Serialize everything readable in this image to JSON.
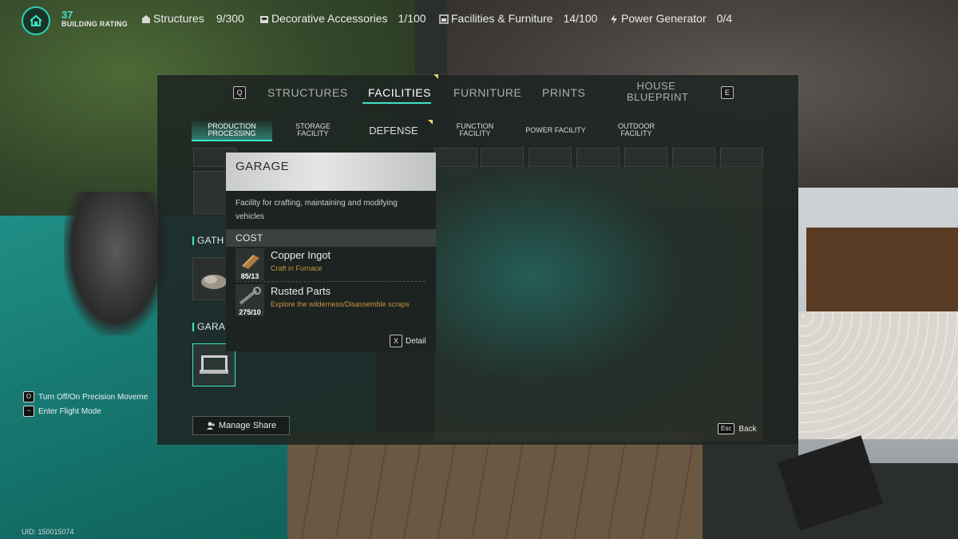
{
  "hud": {
    "rating_value": "37",
    "rating_label": "BUILDING RATING",
    "stats": [
      {
        "label": "Structures",
        "count": "9/300",
        "icon": "structures-icon"
      },
      {
        "label": "Decorative Accessories",
        "count": "1/100",
        "icon": "accessories-icon"
      },
      {
        "label": "Facilities & Furniture",
        "count": "14/100",
        "icon": "facilities-icon"
      },
      {
        "label": "Power Generator",
        "count": "0/4",
        "icon": "power-icon"
      }
    ]
  },
  "tabs": {
    "prev_key": "Q",
    "next_key": "E",
    "items": [
      "STRUCTURES",
      "FACILITIES",
      "FURNITURE",
      "PRINTS"
    ],
    "house_blueprint_line1": "HOUSE",
    "house_blueprint_line2": "BLUEPRINT",
    "active": "FACILITIES"
  },
  "subtabs": {
    "production_l1": "PRODUCTION",
    "production_l2": "PROCESSING",
    "storage_l1": "STORAGE",
    "storage_l2": "FACILITY",
    "defense": "DEFENSE",
    "function_l1": "FUNCTION",
    "function_l2": "FACILITY",
    "power": "POWER FACILITY",
    "outdoor_l1": "OUTDOOR",
    "outdoor_l2": "FACILITY",
    "active": "PRODUCTION PROCESSING"
  },
  "sections": {
    "gathering_partial": "GATH",
    "garage_partial": "GARA"
  },
  "popup": {
    "title": "GARAGE",
    "description": "Facility for crafting, maintaining and modifying vehicles",
    "cost_label": "COST",
    "resources": [
      {
        "name": "Copper Ingot",
        "source": "Craft in Furnace",
        "count": "85/13",
        "icon": "copper-ingot-icon"
      },
      {
        "name": "Rusted Parts",
        "source": "Explore the wilderness/Disassemble scraps",
        "count": "275/10",
        "icon": "rusted-parts-icon"
      }
    ],
    "detail_key": "X",
    "detail_label": "Detail"
  },
  "hints": [
    {
      "key": "O",
      "label": "Turn Off/On Precision Moveme"
    },
    {
      "key": "~",
      "label": "Enter Flight Mode"
    }
  ],
  "manage_share": "Manage Share",
  "back_key": "Esc",
  "back_label": "Back",
  "uid": "UID: 150015074",
  "colors": {
    "accent": "#3fe3c8",
    "source_text": "#c8943f",
    "marker": "#e6d36a"
  }
}
